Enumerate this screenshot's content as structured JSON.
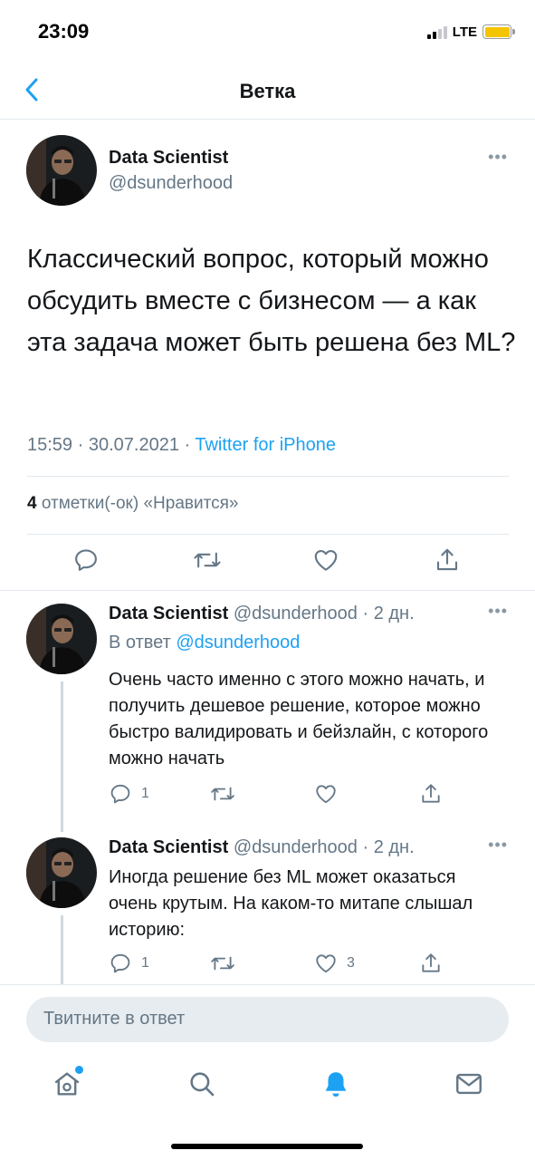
{
  "status_bar": {
    "time": "23:09",
    "network": "LTE"
  },
  "nav": {
    "title": "Ветка"
  },
  "main_tweet": {
    "author_name": "Data Scientist",
    "author_handle": "@dsunderhood",
    "text": "Классический вопрос, который можно обсудить вместе с бизнесом — а как эта задача может быть решена без ML?",
    "time": "15:59",
    "date": "30.07.2021",
    "source": "Twitter for iPhone",
    "likes_count": "4",
    "likes_label": "отметки(-ок) «Нравится»"
  },
  "replies": [
    {
      "author_name": "Data Scientist",
      "author_handle": "@dsunderhood",
      "age": "2 дн.",
      "reply_to_prefix": "В ответ",
      "reply_to_handle": "@dsunderhood",
      "text": "Очень часто именно с этого можно начать, и получить дешевое решение, которое можно быстро валидировать и бейзлайн, с которого можно начать",
      "reply_count": "1",
      "like_count": ""
    },
    {
      "author_name": "Data Scientist",
      "author_handle": "@dsunderhood",
      "age": "2 дн.",
      "text": "Иногда решение без ML может оказаться очень крутым. На каком-то митапе слышал историю:",
      "reply_count": "1",
      "like_count": "3"
    }
  ],
  "composer": {
    "placeholder": "Твитните в ответ"
  },
  "colors": {
    "accent": "#1da1f2",
    "secondary_text": "#657786",
    "battery": "#f5c400"
  },
  "icons": [
    "back-chevron-icon",
    "more-icon",
    "reply-icon",
    "retweet-icon",
    "like-icon",
    "share-icon",
    "home-icon",
    "search-icon",
    "notifications-icon",
    "messages-icon"
  ]
}
